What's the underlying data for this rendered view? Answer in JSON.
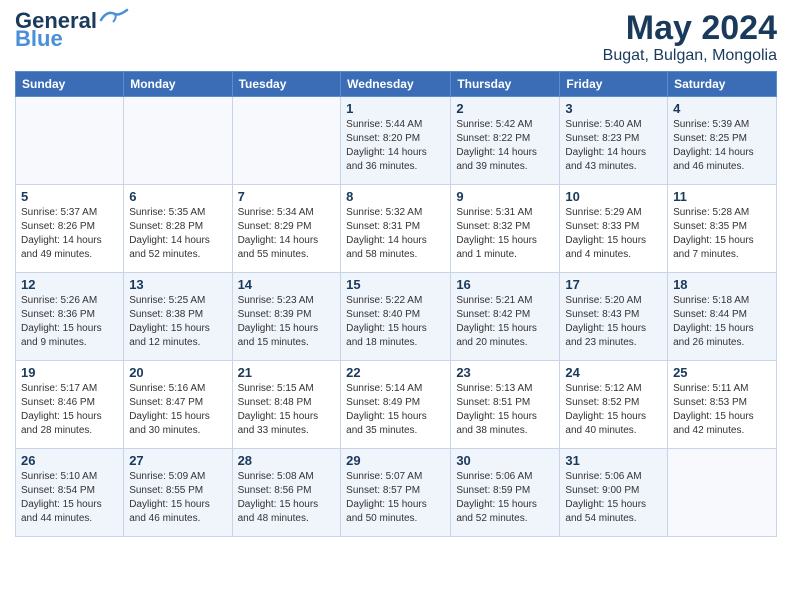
{
  "header": {
    "logo_general": "General",
    "logo_blue": "Blue",
    "title": "May 2024",
    "subtitle": "Bugat, Bulgan, Mongolia"
  },
  "weekdays": [
    "Sunday",
    "Monday",
    "Tuesday",
    "Wednesday",
    "Thursday",
    "Friday",
    "Saturday"
  ],
  "weeks": [
    [
      {
        "day": "",
        "info": ""
      },
      {
        "day": "",
        "info": ""
      },
      {
        "day": "",
        "info": ""
      },
      {
        "day": "1",
        "info": "Sunrise: 5:44 AM\nSunset: 8:20 PM\nDaylight: 14 hours\nand 36 minutes."
      },
      {
        "day": "2",
        "info": "Sunrise: 5:42 AM\nSunset: 8:22 PM\nDaylight: 14 hours\nand 39 minutes."
      },
      {
        "day": "3",
        "info": "Sunrise: 5:40 AM\nSunset: 8:23 PM\nDaylight: 14 hours\nand 43 minutes."
      },
      {
        "day": "4",
        "info": "Sunrise: 5:39 AM\nSunset: 8:25 PM\nDaylight: 14 hours\nand 46 minutes."
      }
    ],
    [
      {
        "day": "5",
        "info": "Sunrise: 5:37 AM\nSunset: 8:26 PM\nDaylight: 14 hours\nand 49 minutes."
      },
      {
        "day": "6",
        "info": "Sunrise: 5:35 AM\nSunset: 8:28 PM\nDaylight: 14 hours\nand 52 minutes."
      },
      {
        "day": "7",
        "info": "Sunrise: 5:34 AM\nSunset: 8:29 PM\nDaylight: 14 hours\nand 55 minutes."
      },
      {
        "day": "8",
        "info": "Sunrise: 5:32 AM\nSunset: 8:31 PM\nDaylight: 14 hours\nand 58 minutes."
      },
      {
        "day": "9",
        "info": "Sunrise: 5:31 AM\nSunset: 8:32 PM\nDaylight: 15 hours\nand 1 minute."
      },
      {
        "day": "10",
        "info": "Sunrise: 5:29 AM\nSunset: 8:33 PM\nDaylight: 15 hours\nand 4 minutes."
      },
      {
        "day": "11",
        "info": "Sunrise: 5:28 AM\nSunset: 8:35 PM\nDaylight: 15 hours\nand 7 minutes."
      }
    ],
    [
      {
        "day": "12",
        "info": "Sunrise: 5:26 AM\nSunset: 8:36 PM\nDaylight: 15 hours\nand 9 minutes."
      },
      {
        "day": "13",
        "info": "Sunrise: 5:25 AM\nSunset: 8:38 PM\nDaylight: 15 hours\nand 12 minutes."
      },
      {
        "day": "14",
        "info": "Sunrise: 5:23 AM\nSunset: 8:39 PM\nDaylight: 15 hours\nand 15 minutes."
      },
      {
        "day": "15",
        "info": "Sunrise: 5:22 AM\nSunset: 8:40 PM\nDaylight: 15 hours\nand 18 minutes."
      },
      {
        "day": "16",
        "info": "Sunrise: 5:21 AM\nSunset: 8:42 PM\nDaylight: 15 hours\nand 20 minutes."
      },
      {
        "day": "17",
        "info": "Sunrise: 5:20 AM\nSunset: 8:43 PM\nDaylight: 15 hours\nand 23 minutes."
      },
      {
        "day": "18",
        "info": "Sunrise: 5:18 AM\nSunset: 8:44 PM\nDaylight: 15 hours\nand 26 minutes."
      }
    ],
    [
      {
        "day": "19",
        "info": "Sunrise: 5:17 AM\nSunset: 8:46 PM\nDaylight: 15 hours\nand 28 minutes."
      },
      {
        "day": "20",
        "info": "Sunrise: 5:16 AM\nSunset: 8:47 PM\nDaylight: 15 hours\nand 30 minutes."
      },
      {
        "day": "21",
        "info": "Sunrise: 5:15 AM\nSunset: 8:48 PM\nDaylight: 15 hours\nand 33 minutes."
      },
      {
        "day": "22",
        "info": "Sunrise: 5:14 AM\nSunset: 8:49 PM\nDaylight: 15 hours\nand 35 minutes."
      },
      {
        "day": "23",
        "info": "Sunrise: 5:13 AM\nSunset: 8:51 PM\nDaylight: 15 hours\nand 38 minutes."
      },
      {
        "day": "24",
        "info": "Sunrise: 5:12 AM\nSunset: 8:52 PM\nDaylight: 15 hours\nand 40 minutes."
      },
      {
        "day": "25",
        "info": "Sunrise: 5:11 AM\nSunset: 8:53 PM\nDaylight: 15 hours\nand 42 minutes."
      }
    ],
    [
      {
        "day": "26",
        "info": "Sunrise: 5:10 AM\nSunset: 8:54 PM\nDaylight: 15 hours\nand 44 minutes."
      },
      {
        "day": "27",
        "info": "Sunrise: 5:09 AM\nSunset: 8:55 PM\nDaylight: 15 hours\nand 46 minutes."
      },
      {
        "day": "28",
        "info": "Sunrise: 5:08 AM\nSunset: 8:56 PM\nDaylight: 15 hours\nand 48 minutes."
      },
      {
        "day": "29",
        "info": "Sunrise: 5:07 AM\nSunset: 8:57 PM\nDaylight: 15 hours\nand 50 minutes."
      },
      {
        "day": "30",
        "info": "Sunrise: 5:06 AM\nSunset: 8:59 PM\nDaylight: 15 hours\nand 52 minutes."
      },
      {
        "day": "31",
        "info": "Sunrise: 5:06 AM\nSunset: 9:00 PM\nDaylight: 15 hours\nand 54 minutes."
      },
      {
        "day": "",
        "info": ""
      }
    ]
  ]
}
